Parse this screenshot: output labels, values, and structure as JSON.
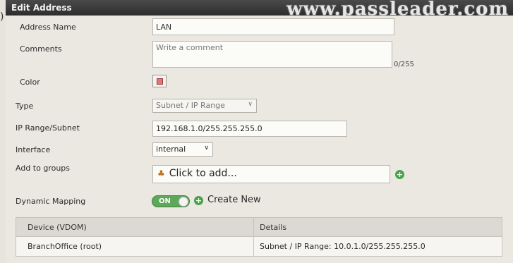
{
  "window": {
    "title": "Edit Address",
    "watermark": "www.passleader.com",
    "edge_glyph": ")"
  },
  "form": {
    "address_name": {
      "label": "Address Name",
      "value": "LAN"
    },
    "comments": {
      "label": "Comments",
      "placeholder": "Write a comment",
      "counter": "0/255"
    },
    "color": {
      "label": "Color",
      "swatch": "#e07878"
    },
    "type": {
      "label": "Type",
      "value": "Subnet / IP Range"
    },
    "ip_range": {
      "label": "IP Range/Subnet",
      "value": "192.168.1.0/255.255.255.0"
    },
    "interface": {
      "label": "Interface",
      "value": "internal"
    },
    "add_to_groups": {
      "label": "Add to groups",
      "placeholder": "Click to add..."
    },
    "dynamic_mapping": {
      "label": "Dynamic Mapping",
      "toggle": "ON",
      "create_new": "Create New"
    }
  },
  "table": {
    "headers": [
      "Device (VDOM)",
      "Details"
    ],
    "rows": [
      [
        "BranchOffice (root)",
        "Subnet / IP Range: 10.0.1.0/255.255.255.0"
      ]
    ]
  },
  "colors": {
    "title_bg": "#333333",
    "accent_green": "#5ea85b",
    "panel_bg": "#eae8e1"
  }
}
